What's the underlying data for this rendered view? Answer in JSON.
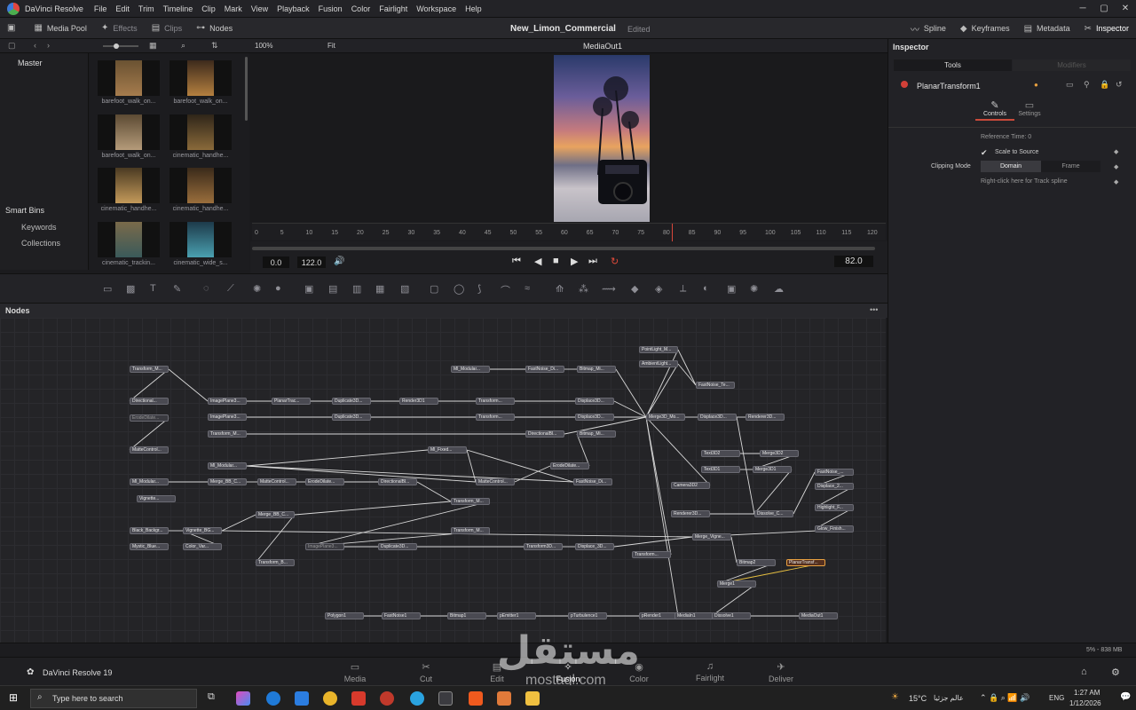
{
  "app": {
    "name": "DaVinci Resolve",
    "menu": [
      "File",
      "Edit",
      "Trim",
      "Timeline",
      "Clip",
      "Mark",
      "View",
      "Playback",
      "Fusion",
      "Color",
      "Fairlight",
      "Workspace",
      "Help"
    ]
  },
  "toolbar": {
    "media_pool": "Media Pool",
    "effects": "Effects",
    "clips": "Clips",
    "nodes": "Nodes",
    "project_title": "New_Limon_Commercial",
    "edit_state": "Edited",
    "spline": "Spline",
    "keyframes": "Keyframes",
    "metadata": "Metadata",
    "inspector": "Inspector"
  },
  "viewer": {
    "zoom": "100%",
    "fit": "Fit",
    "title": "MediaOut1",
    "in_tc": "0.0",
    "out_tc": "122.0",
    "current_frame": "82.0",
    "ruler_ticks": [
      "0",
      "5",
      "10",
      "15",
      "20",
      "25",
      "30",
      "35",
      "40",
      "45",
      "50",
      "55",
      "60",
      "65",
      "70",
      "75",
      "80",
      "85",
      "90",
      "95",
      "100",
      "105",
      "110",
      "115",
      "120"
    ]
  },
  "media_pool": {
    "bin": "Master",
    "smart_bins": "Smart Bins",
    "keywords": "Keywords",
    "collections": "Collections",
    "clips": [
      "barefoot_walk_on...",
      "barefoot_walk_on...",
      "barefoot_walk_on...",
      "cinematic_handhe...",
      "cinematic_handhe...",
      "cinematic_handhe...",
      "cinematic_trackin...",
      "cinematic_wide_s..."
    ]
  },
  "inspector": {
    "title": "Inspector",
    "tabs": [
      "Tools",
      "Modifiers"
    ],
    "tool_name": "PlanarTransform1",
    "subtabs": [
      "Controls",
      "Settings"
    ],
    "reference_time": "Reference Time: 0",
    "scale_to_source": "Scale to Source",
    "clipping_mode_label": "Clipping Mode",
    "clipping_options": [
      "Domain",
      "Frame"
    ],
    "hint": "Right-click here for Track spline"
  },
  "nodes_panel": {
    "title": "Nodes"
  },
  "status": {
    "memory": "5% - 838 MB"
  },
  "footer": {
    "brand": "DaVinci Resolve 19",
    "pages": [
      "Media",
      "Cut",
      "Edit",
      "Fusion",
      "Color",
      "Fairlight",
      "Deliver"
    ],
    "active_page": "Fusion"
  },
  "taskbar": {
    "search_placeholder": "Type here to search",
    "weather": "15°C",
    "weather_note": "عالم جزئيا",
    "lang": "ENG",
    "time": "1:27 AM",
    "date": "1/12/2026"
  },
  "watermark": {
    "text": "مستقل",
    "sub": "mostaql.com"
  },
  "nodes": [
    {
      "id": "n1",
      "label": "Transform_M..."
    },
    {
      "id": "n2",
      "label": "Directional..."
    },
    {
      "id": "n3",
      "label": "ErodeDilate..."
    },
    {
      "id": "n4",
      "label": "MatteControl..."
    },
    {
      "id": "n5",
      "label": "Ml_Modular..."
    },
    {
      "id": "n6",
      "label": "Vignette..."
    },
    {
      "id": "n7",
      "label": "Black_Backgr..."
    },
    {
      "id": "n8",
      "label": "Mystic_Blue..."
    },
    {
      "id": "n9",
      "label": "Vignette_BG..."
    },
    {
      "id": "n10",
      "label": "Color_Var..."
    },
    {
      "id": "n11",
      "label": "ImagePlane3..."
    },
    {
      "id": "n12",
      "label": "ImagePlane3..."
    },
    {
      "id": "n13",
      "label": "Transform_M..."
    },
    {
      "id": "n14",
      "label": "Ml_Modular..."
    },
    {
      "id": "n15",
      "label": "Merge_BB_C..."
    },
    {
      "id": "n16",
      "label": "MatteControl..."
    },
    {
      "id": "n17",
      "label": "ErodeDilate..."
    },
    {
      "id": "n18",
      "label": "DirectionalBl..."
    },
    {
      "id": "n19",
      "label": "Merge_BB_C..."
    },
    {
      "id": "n20",
      "label": "Transform_B..."
    },
    {
      "id": "n21",
      "label": "ImagePlane3..."
    },
    {
      "id": "n22",
      "label": "PlanarTrac..."
    },
    {
      "id": "n23",
      "label": "Duplicate3D..."
    },
    {
      "id": "n24",
      "label": "Duplicate3D..."
    },
    {
      "id": "n25",
      "label": "Render3D1"
    },
    {
      "id": "n26",
      "label": "Transform..."
    },
    {
      "id": "n27",
      "label": "Transform..."
    },
    {
      "id": "n28",
      "label": "Ml_Modular..."
    },
    {
      "id": "n29",
      "label": "FastNoise_Di..."
    },
    {
      "id": "n30",
      "label": "Bitmap_Mi..."
    },
    {
      "id": "n31",
      "label": "Displace3D..."
    },
    {
      "id": "n32",
      "label": "Displace3D..."
    },
    {
      "id": "n33",
      "label": "DirectionalBl..."
    },
    {
      "id": "n34",
      "label": "Bitmap_Mi..."
    },
    {
      "id": "n35",
      "label": "Ml_Fixed..."
    },
    {
      "id": "n36",
      "label": "ErodeDilate..."
    },
    {
      "id": "n37",
      "label": "MatteControl..."
    },
    {
      "id": "n38",
      "label": "FastNoise_Di..."
    },
    {
      "id": "n39",
      "label": "Transform_M..."
    },
    {
      "id": "n40",
      "label": "Transform_M..."
    },
    {
      "id": "n41",
      "label": "Duplicate3D..."
    },
    {
      "id": "n42",
      "label": "Transform3D..."
    },
    {
      "id": "n43",
      "label": "Displace_3D..."
    },
    {
      "id": "n44",
      "label": "PointLight_M..."
    },
    {
      "id": "n45",
      "label": "AmbientLight..."
    },
    {
      "id": "n46",
      "label": "FastNoise_Te..."
    },
    {
      "id": "n47",
      "label": "Merge3D_Mo..."
    },
    {
      "id": "n48",
      "label": "Displace3D..."
    },
    {
      "id": "n49",
      "label": "Renderer3D..."
    },
    {
      "id": "n50",
      "label": "Text3D2"
    },
    {
      "id": "n51",
      "label": "Merge3D2"
    },
    {
      "id": "n52",
      "label": "Text3D1"
    },
    {
      "id": "n53",
      "label": "Merge3D1"
    },
    {
      "id": "n54",
      "label": "Camera3D2"
    },
    {
      "id": "n55",
      "label": "Renderer3D..."
    },
    {
      "id": "n56",
      "label": "Dissolve_C..."
    },
    {
      "id": "n57",
      "label": "Merge_Vigne..."
    },
    {
      "id": "n58",
      "label": "Transform..."
    },
    {
      "id": "n59",
      "label": "Bitmap2"
    },
    {
      "id": "n60",
      "label": "PlanarTransf..."
    },
    {
      "id": "n61",
      "label": "Merge1"
    },
    {
      "id": "n62",
      "label": "FastNoise_..."
    },
    {
      "id": "n63",
      "label": "Displace_2..."
    },
    {
      "id": "n64",
      "label": "Highlight_F..."
    },
    {
      "id": "n65",
      "label": "Glow_Finish..."
    },
    {
      "id": "n66",
      "label": "Polygon1"
    },
    {
      "id": "n67",
      "label": "FastNoise1"
    },
    {
      "id": "n68",
      "label": "Bitmap1"
    },
    {
      "id": "n69",
      "label": "pEmitter1"
    },
    {
      "id": "n70",
      "label": "pTurbulence1"
    },
    {
      "id": "n71",
      "label": "pRender1"
    },
    {
      "id": "n72",
      "label": "MediaIn1"
    },
    {
      "id": "n73",
      "label": "Dissolve1"
    },
    {
      "id": "n74",
      "label": "MediaOut1"
    }
  ]
}
